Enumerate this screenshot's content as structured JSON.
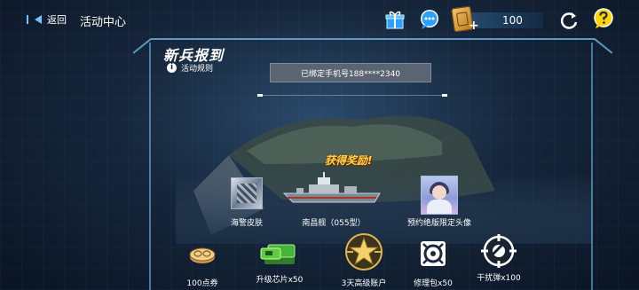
{
  "topbar": {
    "back_label": "返回",
    "title": "活动中心",
    "currency_value": "100"
  },
  "panel": {
    "title": "新兵报到",
    "rules_label": "活动规则",
    "phone_bound_text": "已绑定手机号188****2340",
    "reward_banner": "获得奖励!"
  },
  "rewards_top": [
    {
      "label": "海警皮肤",
      "icon": "skin-icon"
    },
    {
      "label": "南昌舰（055型）",
      "icon": "warship-icon"
    },
    {
      "label": "预约绝版限定头像",
      "icon": "avatar-icon"
    }
  ],
  "rewards_bottom": [
    {
      "label": "100点券",
      "icon": "coupon-icon"
    },
    {
      "label": "升级芯片x50",
      "icon": "chip-icon"
    },
    {
      "label": "3天高级账户",
      "icon": "premium-star-icon"
    },
    {
      "label": "修理包x50",
      "icon": "repair-kit-icon"
    },
    {
      "label": "干扰弹x100",
      "icon": "jammer-icon"
    }
  ],
  "colors": {
    "accent": "#6fc3ff",
    "reward_gold": "#ffd24a",
    "help_yellow": "#ffd400",
    "chat_blue": "#2aa0ff"
  }
}
